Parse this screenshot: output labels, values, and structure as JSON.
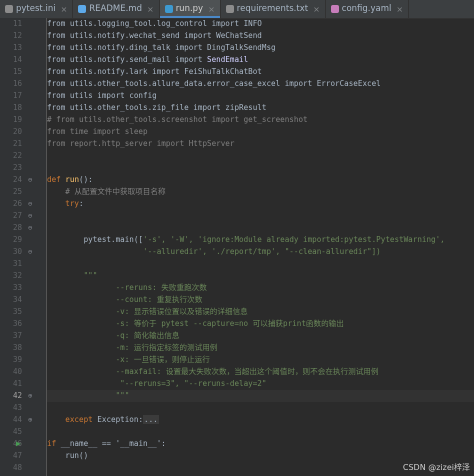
{
  "tabs": [
    {
      "label": "pytest.ini",
      "color": "#8c8c8c",
      "active": false
    },
    {
      "label": "README.md",
      "color": "#5da9e9",
      "active": false
    },
    {
      "label": "run.py",
      "color": "#3d9ad1",
      "active": true
    },
    {
      "label": "requirements.txt",
      "color": "#8c8c8c",
      "active": false
    },
    {
      "label": "config.yaml",
      "color": "#c77dbb",
      "active": false
    }
  ],
  "line_numbers": [
    "11",
    "12",
    "13",
    "14",
    "15",
    "16",
    "17",
    "18",
    "19",
    "20",
    "21",
    "22",
    "23",
    "24",
    "25",
    "26",
    "27",
    "28",
    "29",
    "30",
    "31",
    "32",
    "33",
    "34",
    "35",
    "36",
    "37",
    "38",
    "39",
    "40",
    "41",
    "42",
    "43",
    "44",
    "45",
    "46",
    "47",
    "48"
  ],
  "code": {
    "l11": "from utils.logging_tool.log_control import INFO",
    "l12": "from utils.notify.wechat_send import WeChatSend",
    "l13": "from utils.notify.ding_talk import DingTalkSendMsg",
    "l14_a": "from utils.notify.send_mail import ",
    "l14_b": "SendEmail",
    "l15": "from utils.notify.lark import FeiShuTalkChatBot",
    "l16": "from utils.other_tools.allure_data.error_case_excel import ErrorCaseExcel",
    "l17": "from utils import config",
    "l18": "from utils.other_tools.zip_file import zipResult",
    "l19": "# from utils.other_tools.screenshot import get_screenshot",
    "l20": "from time import sleep",
    "l21": "from report.http_server import HttpServer",
    "l24_kw": "def ",
    "l24_fn": "run",
    "l24_rest": "():",
    "l25": "    # 从配置文件中获取项目名称",
    "l26_kw": "    try",
    "l26_rest": ":",
    "l29_a": "        pytest.main([",
    "l29_b": "'-s', '-W', 'ignore:Module already imported:pytest.PytestWarning',",
    "l30": "                     '--alluredir', './report/tmp', \"--clean-alluredir\"])",
    "l32": "        \"\"\"",
    "l33": "               --reruns: 失败重跑次数",
    "l34": "               --count: 重复执行次数",
    "l35": "               -v: 显示错误位置以及错误的详细信息",
    "l36": "               -s: 等价于 pytest --capture=no 可以捕获print函数的输出",
    "l37": "               -q: 简化输出信息",
    "l38": "               -m: 运行指定标签的测试用例",
    "l39": "               -x: 一旦错误，则停止运行",
    "l40": "               --maxfail: 设置最大失败次数，当超出这个阈值时，则不会在执行测试用例",
    "l41": "                \"--reruns=3\", \"--reruns-delay=2\"",
    "l42": "               \"\"\"",
    "l44_kw": "    except ",
    "l44_rest": "Exception:",
    "l44_fold": "...",
    "l47_kw": "if ",
    "l47_rest": "__name__ == '__main__':",
    "l48": "    run()"
  },
  "watermark": "CSDN @zizei梓泽"
}
